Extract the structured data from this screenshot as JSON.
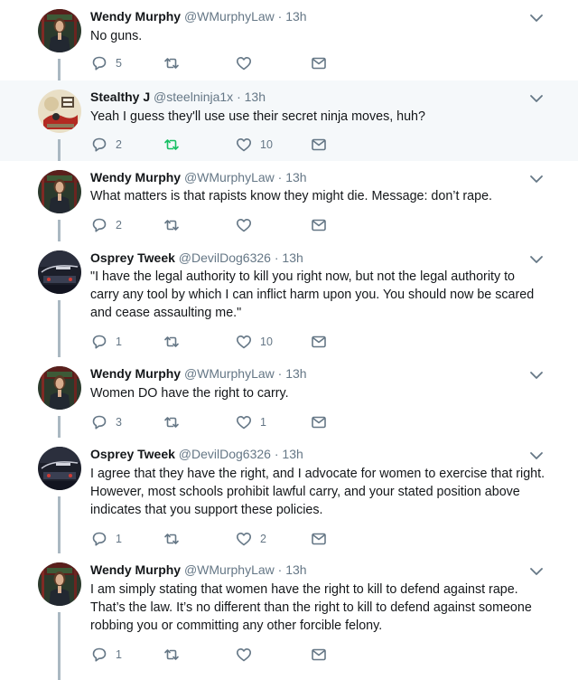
{
  "colors": {
    "text": "#14171a",
    "muted": "#657786",
    "icon": "#657786",
    "retweeted": "#17bf63",
    "connector": "#aab8c2",
    "highlight_bg": "#f5f8fa"
  },
  "tweets": [
    {
      "name": "Wendy Murphy",
      "handle": "@WMurphyLaw",
      "sep": "·",
      "time": "13h",
      "text": [
        "No guns."
      ],
      "replies": "5",
      "retweets": "",
      "likes": "",
      "avatar": "wendy"
    },
    {
      "name": "Stealthy J",
      "handle": "@steelninja1x",
      "sep": "·",
      "time": "13h",
      "text": [
        "Yeah I guess they'll use use their secret ninja moves, huh?"
      ],
      "replies": "2",
      "retweets": "",
      "likes": "10",
      "retweeted": true,
      "avatar": "ninja"
    },
    {
      "name": "Wendy Murphy",
      "handle": "@WMurphyLaw",
      "sep": "·",
      "time": "13h",
      "text": [
        "What matters is that rapists know they might die. Message: don’t rape."
      ],
      "replies": "2",
      "retweets": "",
      "likes": "",
      "avatar": "wendy"
    },
    {
      "name": "Osprey Tweek",
      "handle": "@DevilDog6326",
      "sep": "·",
      "time": "13h",
      "text": [
        "\"I have the legal authority to kill you right now, but not the legal authority to",
        "carry any tool by which I can inflict harm upon you. You should now be scared",
        "and cease assaulting me.\""
      ],
      "replies": "1",
      "retweets": "",
      "likes": "10",
      "avatar": "osprey"
    },
    {
      "name": "Wendy Murphy",
      "handle": "@WMurphyLaw",
      "sep": "·",
      "time": "13h",
      "text": [
        "Women DO have the right to carry."
      ],
      "replies": "3",
      "retweets": "",
      "likes": "1",
      "avatar": "wendy"
    },
    {
      "name": "Osprey Tweek",
      "handle": "@DevilDog6326",
      "sep": "·",
      "time": "13h",
      "text": [
        "I agree that they have the right, and I advocate for women to exercise that right.",
        "However, most schools prohibit lawful carry, and your stated position above",
        "indicates that you support these policies."
      ],
      "replies": "1",
      "retweets": "",
      "likes": "2",
      "avatar": "osprey"
    },
    {
      "name": "Wendy Murphy",
      "handle": "@WMurphyLaw",
      "sep": "·",
      "time": "13h",
      "text": [
        "I am simply stating that women have the right to kill to defend against rape.",
        "That’s the law. It’s no different than the right to kill to defend against someone",
        "robbing you or committing any other forcible felony."
      ],
      "replies": "1",
      "retweets": "",
      "likes": "",
      "avatar": "wendy"
    }
  ]
}
